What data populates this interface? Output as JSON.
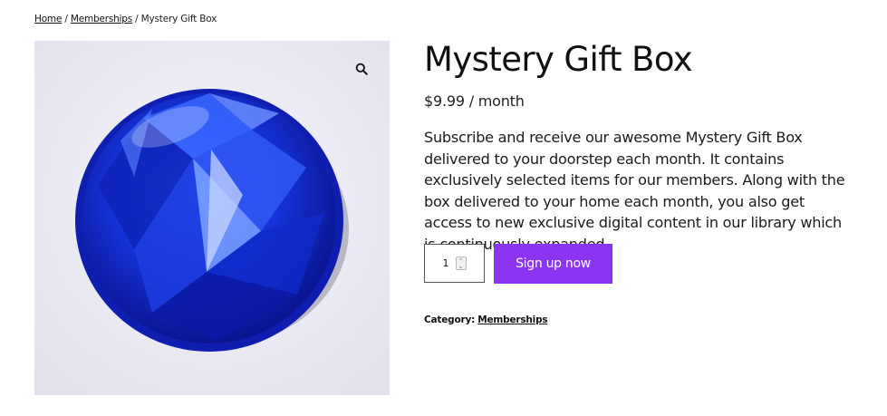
{
  "breadcrumb": {
    "home": "Home",
    "separator": " / ",
    "category": "Memberships",
    "current": "Mystery Gift Box"
  },
  "product": {
    "title": "Mystery Gift Box",
    "price": "$9.99 / month",
    "description": "Subscribe and receive our awesome Mystery Gift Box delivered to your doorstep each month. It contains exclusively selected items for our members. Along with the box delivered to your home each month, you also get access to new exclusive digital content in our library which is continuously expanded.",
    "image_icon": "blue-gem-image",
    "zoom_icon": "magnifier-icon"
  },
  "cart": {
    "quantity": "1",
    "button_label": "Sign up now",
    "button_color": "#8b35f2"
  },
  "meta": {
    "category_label": "Category:",
    "category_value": "Memberships"
  }
}
